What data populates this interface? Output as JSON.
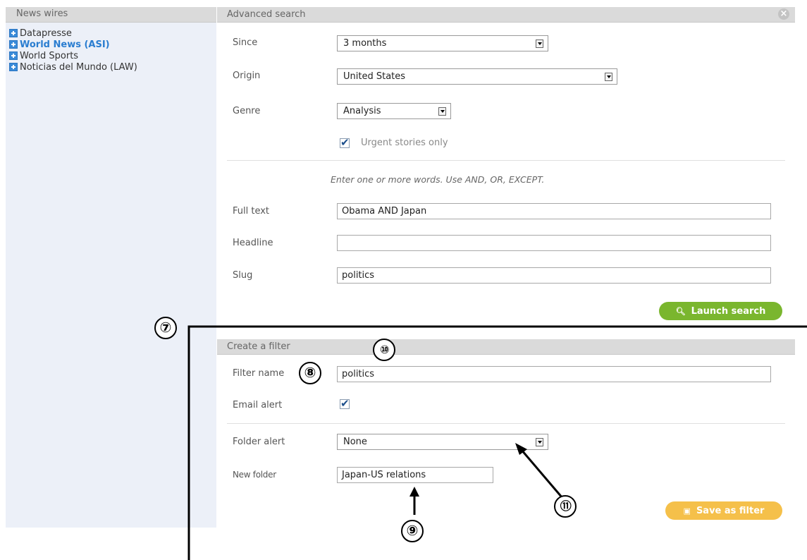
{
  "sidebar": {
    "title": "News wires",
    "items": [
      {
        "label": "Datapresse"
      },
      {
        "label": "World News (ASI)"
      },
      {
        "label": "World Sports"
      },
      {
        "label": "Noticias del Mundo (LAW)"
      }
    ]
  },
  "search": {
    "title": "Advanced search",
    "since_label": "Since",
    "since_value": "3 months",
    "origin_label": "Origin",
    "origin_value": "United States",
    "genre_label": "Genre",
    "genre_value": "Analysis",
    "urgent_label": "Urgent stories only",
    "urgent_checked": true,
    "hint": "Enter one or more words. Use AND, OR, EXCEPT.",
    "fulltext_label": "Full text",
    "fulltext_value": "Obama AND Japan",
    "headline_label": "Headline",
    "headline_value": "",
    "slug_label": "Slug",
    "slug_value": "politics",
    "launch_label": "Launch search"
  },
  "filter": {
    "title": "Create a filter",
    "name_label": "Filter name",
    "name_value": "politics",
    "email_label": "Email alert",
    "email_checked": true,
    "folder_label": "Folder alert",
    "folder_value": "None",
    "newfolder_label": "New folder",
    "newfolder_value": "Japan-US relations",
    "save_label": "Save as filter"
  },
  "annotations": {
    "c7": "⑦",
    "c8": "⑧",
    "c9": "⑨",
    "c10": "⑩",
    "c11": "⑪"
  }
}
